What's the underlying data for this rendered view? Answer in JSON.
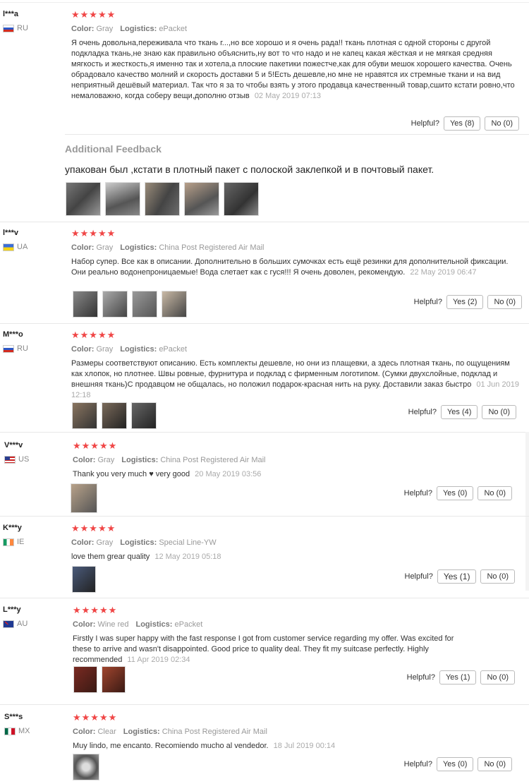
{
  "helpful_label": "Helpful?",
  "color_key": "Color:",
  "logistics_key": "Logistics:",
  "stars": "★★★★★",
  "colors": {
    "star": "#f04646"
  },
  "reviews": [
    {
      "name": "l***a",
      "country": "RU",
      "color": "Gray",
      "logistics": "ePacket",
      "text": "Я очень довольна,переживала что ткань г...,но все хорошо и я очень рада!! ткань плотная с одной стороны с другой подкладка ткань,не знаю как правильно объяснить,ну вот то что надо и не капец какая жёсткая и не мягкая средняя мягкость и жесткость,я именно так и хотела,а плоские пакетики пожестче,как для обуви мешок хорошего качества. Очень обрадовало качество молний и скорость доставки 5 и 5!Есть дешевле,но мне не нравятся их стремные ткани и на вид неприятный дешёвый материал. Так что я за то чтобы взять у этого продавца качественный товар,сшито кстати ровно,что немаловажно, когда соберу вещи,дополню отзыв",
      "date": "02 May 2019 07:13",
      "yes": "Yes (8)",
      "no": "No (0)"
    },
    {
      "name": "l***v",
      "country": "UA",
      "color": "Gray",
      "logistics": "China Post Registered Air Mail",
      "text": "Набор супер. Все как в описании. Дополнительно в больших сумочках есть ещё резинки для дополнительной фиксации. Они реально водонепроницаемые! Вода слетает как с гуся!!! Я очень доволен, рекомендую.",
      "date": "22 May 2019 06:47",
      "yes": "Yes (2)",
      "no": "No (0)"
    },
    {
      "name": "M***o",
      "country": "RU",
      "color": "Gray",
      "logistics": "ePacket",
      "text": "Размеры соответствуют описанию. Есть комплекты дешевле, но они из плащевки, а здесь плотная ткань, по ощущениям как хлопок, но плотнее. Швы ровные, фурнитура и подклад с фирменным логотипом. (Сумки двухслойные, подклад и внешняя ткань)С продавцом не общалась, но положил подарок-красная нить на руку. Доставили заказ быстро",
      "date": "01 Jun 2019 12:18",
      "yes": "Yes (4)",
      "no": "No (0)"
    },
    {
      "name": "V***v",
      "country": "US",
      "color": "Gray",
      "logistics": "China Post Registered Air Mail",
      "text": "Thank you very much ♥ very good",
      "date": "20 May 2019 03:56",
      "yes": "Yes (0)",
      "no": "No (0)"
    },
    {
      "name": "K***y",
      "country": "IE",
      "color": "Gray",
      "logistics": "Special Line-YW",
      "text": "love them grear quality",
      "date": "12 May 2019 05:18",
      "yes": "Yes (1)",
      "no": "No (0)"
    },
    {
      "name": "L***y",
      "country": "AU",
      "color": "Wine red",
      "logistics": "ePacket",
      "text": "Firstly I was super happy with the fast response I got from customer service regarding my offer. Was excited for these to arrive and wasn't disappointed. Good price to quality deal. They fit my suitcase perfectly. Highly recommended",
      "date": "11 Apr 2019 02:34",
      "yes": "Yes (1)",
      "no": "No (0)"
    },
    {
      "name": "S***s",
      "country": "MX",
      "color": "Clear",
      "logistics": "China Post Registered Air Mail",
      "text": "Muy lindo, me encanto. Recomiendo mucho al vendedor.",
      "date": "18 Jul 2019 00:14",
      "yes": "Yes (0)",
      "no": "No (0)"
    }
  ],
  "additional": {
    "title": "Additional Feedback",
    "text": "упакован был ,кстати в плотный пакет с полоской заклепкой и в почтовый пакет."
  }
}
